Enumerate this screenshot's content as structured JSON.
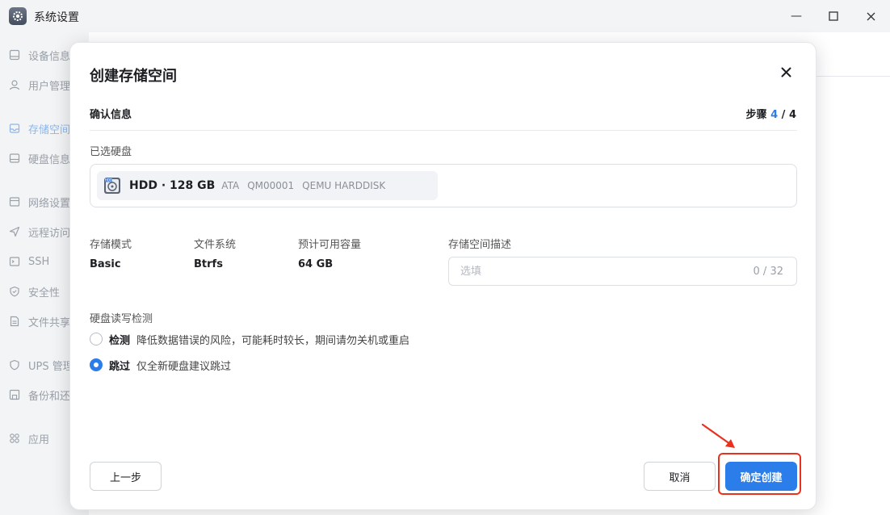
{
  "window": {
    "title": "系统设置",
    "minimize_glyph": "—",
    "maximize_glyph": "☐",
    "close_glyph": "✕"
  },
  "sidebar": {
    "items": [
      {
        "label": "设备信息",
        "icon": "device-icon"
      },
      {
        "label": "用户管理",
        "icon": "user-icon"
      },
      {
        "label": "存储空间",
        "icon": "storage-icon",
        "active": true
      },
      {
        "label": "硬盘信息",
        "icon": "disk-icon"
      },
      {
        "label": "网络设置",
        "icon": "network-icon"
      },
      {
        "label": "远程访问",
        "icon": "send-icon"
      },
      {
        "label": "SSH",
        "icon": "terminal-icon"
      },
      {
        "label": "安全性",
        "icon": "shield-check-icon"
      },
      {
        "label": "文件共享",
        "icon": "file-icon"
      },
      {
        "label": "UPS 管理",
        "icon": "shield-icon"
      },
      {
        "label": "备份和还原",
        "icon": "backup-icon"
      },
      {
        "label": "应用",
        "icon": "apps-icon"
      }
    ]
  },
  "modal": {
    "title": "创建存储空间",
    "section": "确认信息",
    "step_prefix": "步骤",
    "step_current": "4",
    "step_total": "/ 4",
    "selected_disks_label": "已选硬盘",
    "disk": {
      "name": "HDD · 128 GB",
      "bus": "ATA",
      "serial": "QM00001",
      "model": "QEMU HARDDISK",
      "icon_text": "HDD"
    },
    "summary": [
      {
        "label": "存储模式",
        "value": "Basic"
      },
      {
        "label": "文件系统",
        "value": "Btrfs"
      },
      {
        "label": "预计可用容量",
        "value": "64 GB"
      }
    ],
    "description": {
      "label": "存储空间描述",
      "value": "",
      "placeholder": "选填",
      "counter": "0 / 32"
    },
    "check": {
      "label": "硬盘读写检测",
      "options": [
        {
          "label": "检测",
          "desc": "降低数据错误的风险，可能耗时较长，期间请勿关机或重启",
          "selected": false
        },
        {
          "label": "跳过",
          "desc": "仅全新硬盘建议跳过",
          "selected": true
        }
      ]
    },
    "buttons": {
      "prev": "上一步",
      "cancel": "取消",
      "confirm": "确定创建"
    }
  },
  "colors": {
    "accent": "#2b7de9",
    "highlight": "#e8321f"
  }
}
